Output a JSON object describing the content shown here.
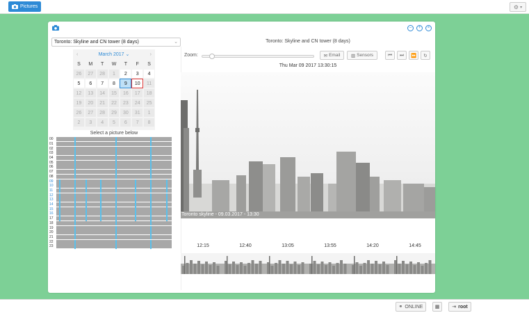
{
  "topbar": {
    "pictures_label": "Pictures",
    "pictures_icon": "camera-icon",
    "settings_icon": "gear-icon"
  },
  "window": {
    "window_icon": "camera-icon",
    "camera_select": {
      "value": "Toronto: Skyline and CN tower (8 days)"
    },
    "title": "Toronto: Skyline and CN tower (8 days)",
    "controls": [
      "minimize-icon",
      "maximize-icon",
      "close-icon"
    ]
  },
  "calendar": {
    "month_label": "March 2017",
    "weekdays": [
      "S",
      "M",
      "T",
      "W",
      "T",
      "F",
      "S"
    ],
    "rows": [
      [
        "26",
        "27",
        "28",
        "1",
        "2",
        "3",
        "4"
      ],
      [
        "5",
        "6",
        "7",
        "8",
        "9",
        "10",
        "11"
      ],
      [
        "12",
        "13",
        "14",
        "15",
        "16",
        "17",
        "18"
      ],
      [
        "19",
        "20",
        "21",
        "22",
        "23",
        "24",
        "25"
      ],
      [
        "26",
        "27",
        "28",
        "29",
        "30",
        "31",
        "1"
      ],
      [
        "2",
        "3",
        "4",
        "5",
        "6",
        "7",
        "8"
      ]
    ],
    "active_days": [
      "2",
      "3",
      "4",
      "5",
      "6",
      "7",
      "8",
      "9",
      "10"
    ],
    "selected_day": "9",
    "today_day": "10"
  },
  "select_label": "Select a picture below",
  "hours": [
    "00",
    "01",
    "02",
    "03",
    "04",
    "05",
    "06",
    "07",
    "08",
    "09",
    "10",
    "11",
    "12",
    "13",
    "14",
    "15",
    "16",
    "17",
    "18",
    "19",
    "20",
    "21",
    "22",
    "23"
  ],
  "toolbar": {
    "zoom_label": "Zoom:",
    "email_label": "Email",
    "sensors_label": "Sensors",
    "nav_icons": [
      "skip-back-icon",
      "skip-forward-icon",
      "fast-forward-icon",
      "refresh-icon"
    ]
  },
  "photo": {
    "timestamp": "Thu Mar 09 2017 13:30:15",
    "caption": "Toronto skyline - 09.03.2017 - 13:30"
  },
  "strip": {
    "times": [
      "12:15",
      "12:40",
      "13:05",
      "13:55",
      "14:20",
      "14:45"
    ]
  },
  "footer": {
    "online_label": "ONLINE",
    "user_label": "root"
  },
  "colors": {
    "background": "#7dd096",
    "accent": "#2d8ad6",
    "marker": "#5bc0eb"
  }
}
